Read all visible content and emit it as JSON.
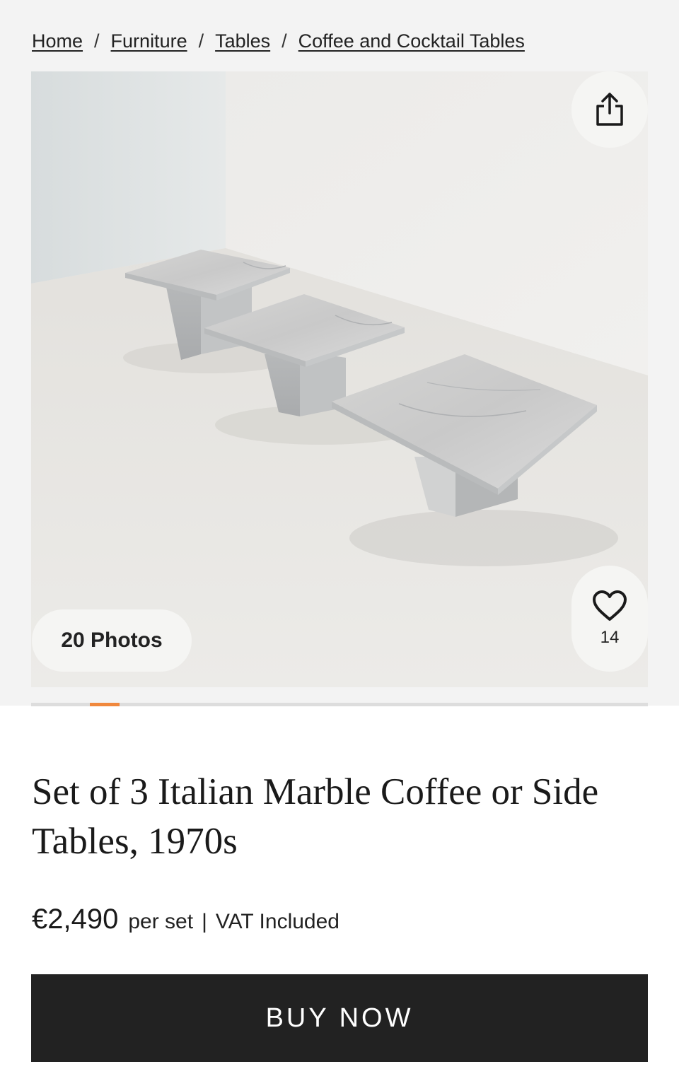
{
  "breadcrumb": {
    "items": [
      {
        "label": "Home"
      },
      {
        "label": "Furniture"
      },
      {
        "label": "Tables"
      },
      {
        "label": "Coffee and Cocktail Tables"
      }
    ],
    "separator": "/"
  },
  "gallery": {
    "photos_label": "20 Photos",
    "favorites_count": "14",
    "share_icon": "share-icon",
    "favorite_icon": "heart-icon",
    "progress": {
      "current_index": 2,
      "fraction_start": 0.095,
      "fraction_end": 0.143,
      "accent_color": "#f0883d"
    }
  },
  "product": {
    "title_line1": "Set of 3 Italian Marble Coffee or Side",
    "title_line2": "Tables, 1970s",
    "price": "€2,490",
    "price_unit": "per set",
    "price_divider": "|",
    "vat_note": "VAT Included"
  },
  "actions": {
    "buy_label": "BUY NOW",
    "buy_color": "#222222"
  }
}
